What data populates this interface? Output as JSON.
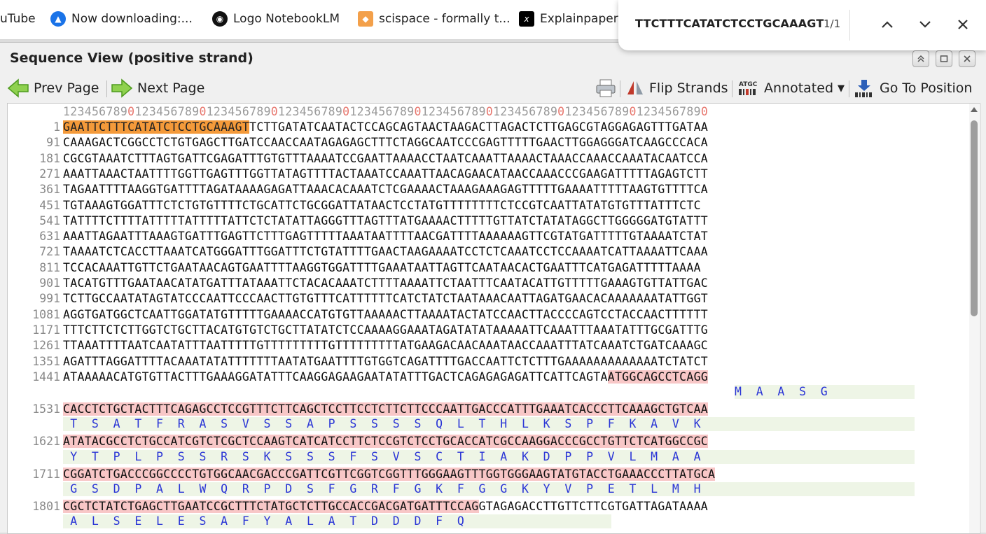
{
  "bookmarks": [
    {
      "label": "uTube"
    },
    {
      "label": "Now downloading:..."
    },
    {
      "label": "Logo NotebookLM"
    },
    {
      "label": "scispace - formally t..."
    },
    {
      "label": "Explainpaper"
    }
  ],
  "find": {
    "query": "TTCTTTCATATCTCCTGCAAAGT",
    "count": "1/1"
  },
  "panel": {
    "title": "Sequence View (positive strand)"
  },
  "toolbar": {
    "prev": "Prev Page",
    "next": "Next Page",
    "flip": "Flip Strands",
    "annotated": "Annotated",
    "goto": "Go To Position"
  },
  "ruler": "123456789012345678901234567890123456789012345678901234567890123456789012345678901234567890",
  "rows": [
    {
      "num": "1",
      "hl": "GAATTCTTTCATATCTCCTGCAAAGT",
      "seq": "TCTTGATATCAATACTCCAGCAGTAACTAAGACTTAGACTCTTGAGCGTAGGAGAGTTTGATAA"
    },
    {
      "num": "91",
      "seq": "CAAAGACTCGGCCTCTGTGAGCTTGATCCAACCAATAGAGAGCTTTCTAGGCAATCCCGAGTTTTTGAACTTGGAGGGATCAAGCCCACA"
    },
    {
      "num": "181",
      "seq": "CGCGTAAATCTTTAGTGATTCGAGATTTGTGTTTAAAATCCGAATTAAAACCTAATCAAATTAAAACTAAACCAAACCAAATACAATCCA"
    },
    {
      "num": "271",
      "seq": "AAATTAAACTAATTTTGGTTGAGTTTGGTTATAGTTTTACTAAATCCAAATTAACAGAACATAACCAAACCCGAAGATTTTTAGAGTCTT"
    },
    {
      "num": "361",
      "seq": "TAGAATTTTAAGGTGATTTTAGATAAAAGAGATTAAACACAAATCTCGAAAACTAAAGAAAGAGTTTTTGAAAATTTTTAAGTGTTTTCA"
    },
    {
      "num": "451",
      "seq": "TGTAAAGTGGATTTCTCTGTGTTTTCTGCATTCTGCGGATTATAACTCCTATGTTTTTTTTCTCCGTCAATTATATGTGTTTATTTCTC"
    },
    {
      "num": "541",
      "seq": "TATTTTCTTTTATTTTTATTTTTATTCTCTATATTAGGGTTTAGTTTATGAAAACTTTTTGTTATCTATATAGGCTTGGGGGATGTATTT"
    },
    {
      "num": "631",
      "seq": "AAATTAGAATTTAAAGTGATTTGAGTTCTTTGAGTTTTTAAATAATTTTAACGATTTTAAAAAAGTTCGTATGATTTTTGTAAAATCTAT"
    },
    {
      "num": "721",
      "seq": "TAAAATCTCACCTTAAATCATGGGATTTGGATTTCTGTATTTTGAACTAAGAAAATCCTCTCAAATCCTCCAAAATCATTAAAATTCAAA"
    },
    {
      "num": "811",
      "seq": "TCCACAAATTGTTCTGAATAACAGTGAATTTTAAGGTGGATTTTGAAATAATTAGTTCAATAACACTGAATTTCATGAGATTTTTAAAA"
    },
    {
      "num": "901",
      "seq": "TACATGTTTGAATAACATATGATTTATAAATTCTACACAAATCTTTTAAAATTCTAATTTCAATACATTGTTTTTGAAAGTGTTATTGAC"
    },
    {
      "num": "991",
      "seq": "TCTTGCCAATATAGTATCCCAATTCCCAACTTGTGTTTCATTTTTTCATCTATCTAATAAACAATTAGATGAACACAAAAAAATATTGGT"
    },
    {
      "num": "1081",
      "seq": "AGGTGATGGCTCAATTGGATATGTTTTTGAAAACCATGTGTTAAAAACTTAAAATACTATCCAACTTACCCCAGTCCTACCAACTTTTTT"
    },
    {
      "num": "1171",
      "seq": "TTTCTTCTCTTGGTCTGCTTACATGTGTCTGCTTATATCTCCAAAAGGAAATAGATATATAAAAATTCAAATTTAAATATTTGCGATTTG"
    },
    {
      "num": "1261",
      "seq": "TTAAATTTTAATCAATATTTAATTTTTGTTTTTTTTTGTTTTTTTTTATGAAGACAACAAATAACCAAATTTATCAAATCTGATCAAAGC"
    },
    {
      "num": "1351",
      "seq": "AGATTTAGGATTTTACAAATATATTTTTTTAATATGAATTTTGTGGTCAGATTTTGACCAATTCTCTTTGAAAAAAAAAAAAATCTATCT"
    },
    {
      "num": "1441",
      "seq": "ATAAAAACATGTGTTACTTTGAAAGGATATTTCAAGGAGAAGAATATATTTGACTCAGAGAGAGATTCATTCAGTA",
      "orf": "ATGGCAGCCTCAGG",
      "prot": "M  A  A  S  G",
      "protLeft": 1038
    },
    {
      "num": "1531",
      "orf": "CACCTCTGCTACTTTCAGAGCCTCCGTTTCTTCAGCTCCTTCCTCTTCTTCCCAATTGACCCATTTGAAATCACCCTTCAAAGCTGTCAA",
      "prot": " T  S  A  T  F  R  A  S  V  S  S  A  P  S  S  S  S  Q  L  T  H  L  K  S  P  F  K  A  V  K"
    },
    {
      "num": "1621",
      "orf": "ATATACGCCTCTGCCATCGTCTCGCTCCAAGTCATCATCCTTCTCCGTCTCCTGCACCATCGCCAAGGACCCGCCTGTTCTCATGGCCGC",
      "prot": " Y  T  P  L  P  S  S  R  S  K  S  S  S  F  S  V  S  C  T  I  A  K  D  P  P  V  L  M  A  A"
    },
    {
      "num": "1711",
      "orf": "CGGATCTGACCCGGCCCCTGTGGCAACGACCCGATTCGTTCGGTCGGTTTGGGAAGTTTGGTGGGAAGTATGTACCTGAAACCCTTATGCA",
      "prot": " G  S  D  P  A  L  W  Q  R  P  D  S  F  G  R  F  G  K  F  G  G  K  Y  V  P  E  T  L  M  H"
    },
    {
      "num": "1801",
      "orf": "CGCTCTATCTGAGCTTGAATCCGCTTTCTATGCTCTTGCCACCGACGATGATTTCCAG",
      "seq": "GTAGAGACCTTGTTCTTCGTGATTAGATAAAA",
      "prot": " A  L  S  E  L  E  S  A  F  Y  A  L  A  T  D  D  D  F  Q"
    }
  ]
}
